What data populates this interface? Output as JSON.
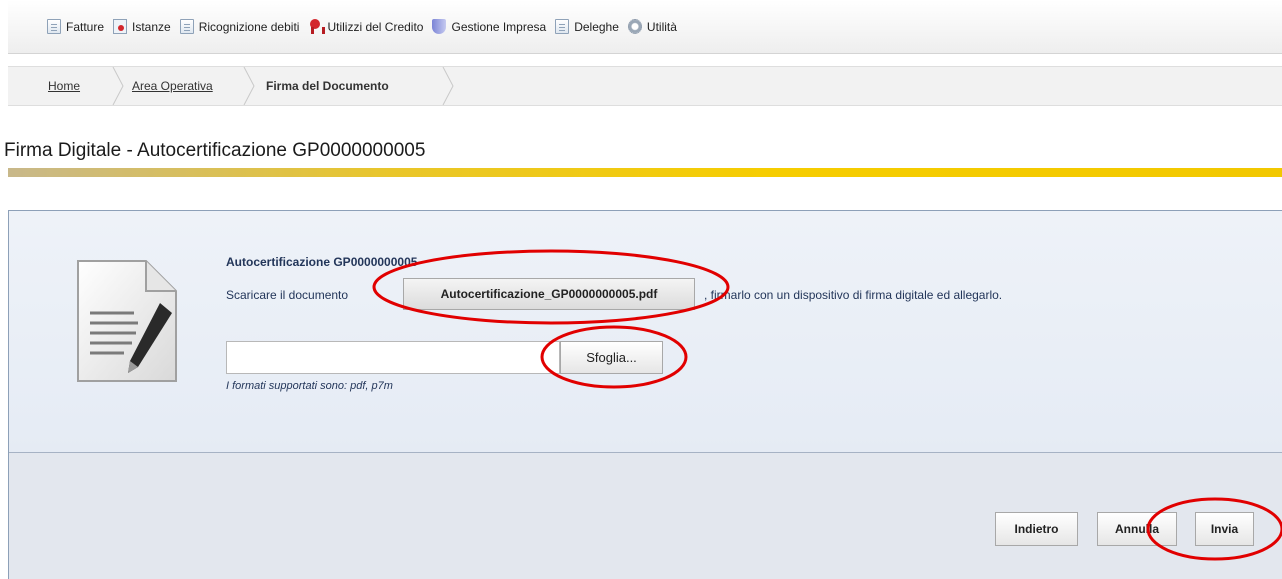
{
  "menu": {
    "items": [
      {
        "label": "Fatture",
        "icon": "document-icon"
      },
      {
        "label": "Istanze",
        "icon": "istanze-icon"
      },
      {
        "label": "Ricognizione debiti",
        "icon": "document-icon"
      },
      {
        "label": "Utilizzi del Credito",
        "icon": "ribbon-icon"
      },
      {
        "label": "Gestione Impresa",
        "icon": "shield-icon"
      },
      {
        "label": "Deleghe",
        "icon": "document-icon"
      },
      {
        "label": "Utilità",
        "icon": "gear-icon"
      }
    ]
  },
  "breadcrumb": {
    "home": "Home",
    "area": "Area Operativa",
    "current": "Firma del Documento"
  },
  "page": {
    "title": "Firma Digitale - Autocertificazione GP0000000005"
  },
  "document": {
    "heading": "Autocertificazione GP0000000005",
    "instruction_prefix": "Scaricare il documento",
    "download_label": "Autocertificazione_GP0000000005.pdf",
    "instruction_suffix": ", firmarlo con un dispositivo di firma digitale ed allegarlo."
  },
  "upload": {
    "value": "",
    "browse_label": "Sfoglia...",
    "formats_hint": "I formati supportati sono: pdf, p7m"
  },
  "footer": {
    "back_label": "Indietro",
    "cancel_label": "Annulla",
    "send_label": "Invia"
  },
  "colors": {
    "accent_bar": "#f6cd00",
    "highlight": "#e10000",
    "text_navy": "#23365a"
  }
}
